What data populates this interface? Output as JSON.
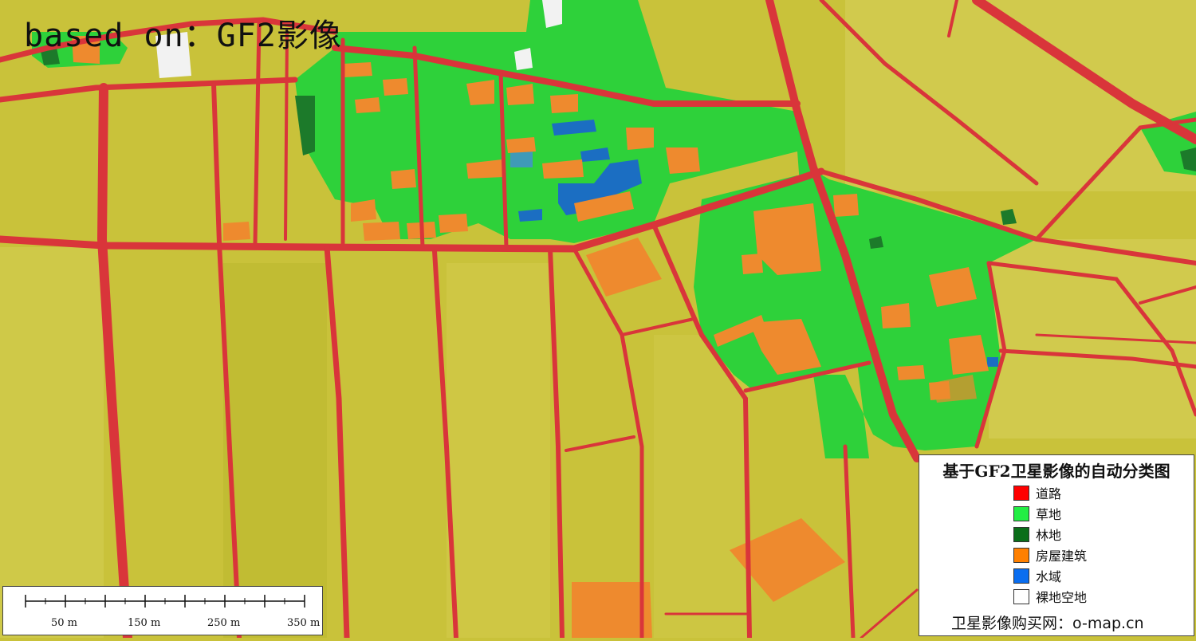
{
  "watermark": "based on：GF2影像",
  "scale_bar": {
    "labels": [
      "50 m",
      "150 m",
      "250 m",
      "350 m"
    ]
  },
  "legend": {
    "title": "基于GF2卫星影像的自动分类图",
    "items": [
      {
        "label": "道路",
        "color": "#ff0000"
      },
      {
        "label": "草地",
        "color": "#22ee44"
      },
      {
        "label": "林地",
        "color": "#0a6e1a"
      },
      {
        "label": "房屋建筑",
        "color": "#ff8000"
      },
      {
        "label": "水域",
        "color": "#0a6ef0"
      },
      {
        "label": "裸地空地",
        "color": "#ffffff"
      }
    ],
    "footer": "卫星影像购买网：o-map.cn"
  },
  "map_colors": {
    "farmland": "#c9c23a",
    "road": "#d9353a",
    "grassland": "#2ed13a",
    "forest": "#1c7a2a",
    "building": "#ee8a2e",
    "water": "#1b6ec2",
    "bare": "#f2f2f2"
  }
}
